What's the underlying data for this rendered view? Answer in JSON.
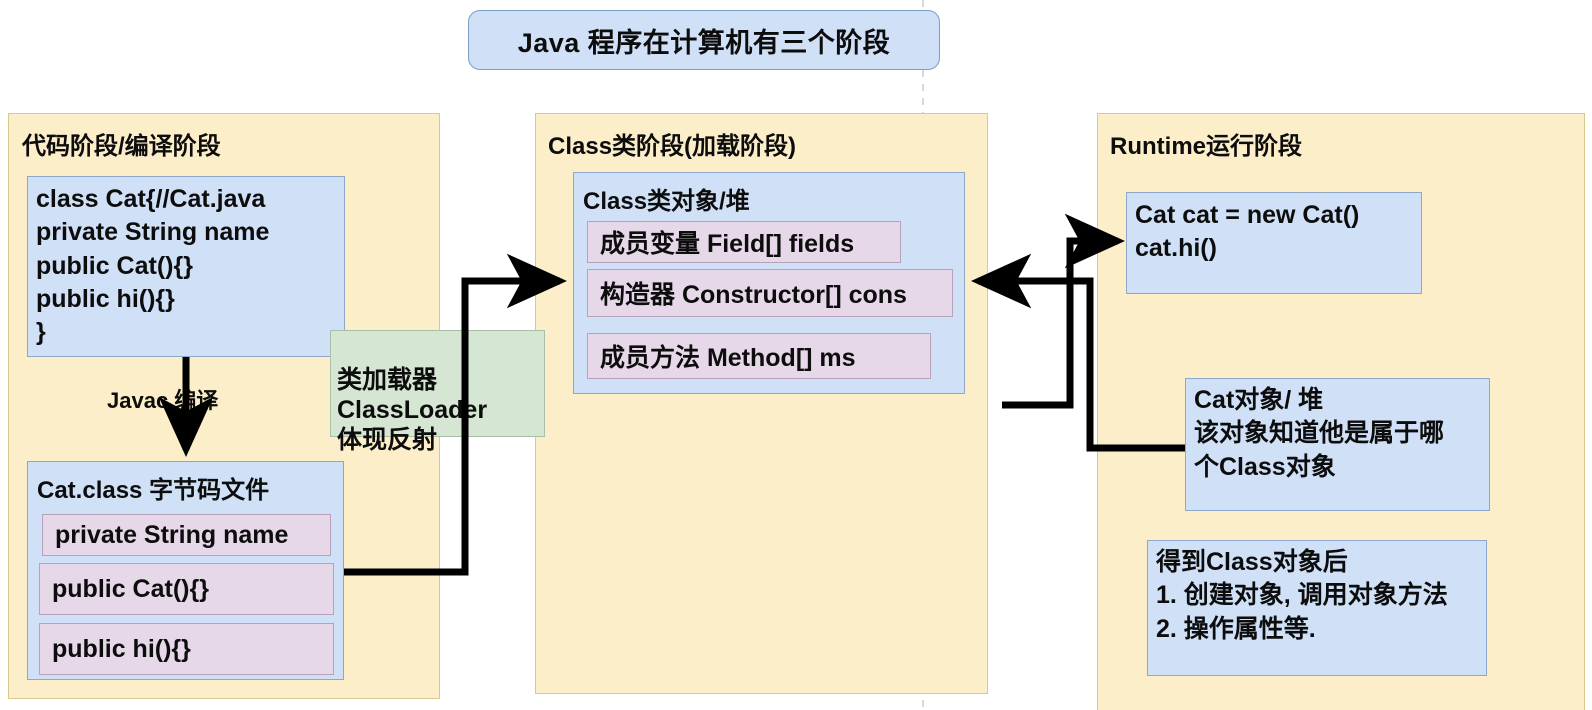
{
  "title": {
    "text": "Java 程序在计算机有三个阶段"
  },
  "stages": [
    {
      "id": "code-stage",
      "title": "代码阶段/编译阶段",
      "source_box": {
        "text": "class Cat{//Cat.java\nprivate String name\npublic Cat(){}\npublic hi(){}\n}"
      },
      "compile_label": "Javac 编译",
      "class_file_box": {
        "header": "Cat.class 字节码文件",
        "members": [
          "private String name",
          "public Cat(){}",
          "public hi(){}"
        ]
      }
    },
    {
      "id": "class-stage",
      "title": "Class类阶段(加载阶段)",
      "class_object_box": {
        "header": "Class类对象/堆",
        "members": [
          "成员变量 Field[] fields",
          "构造器 Constructor[] cons",
          "成员方法 Method[] ms"
        ]
      }
    },
    {
      "id": "runtime-stage",
      "title": "Runtime运行阶段",
      "runtime_code_box": {
        "text": "Cat cat = new Cat()\ncat.hi()"
      },
      "cat_object_box": {
        "text": "Cat对象/ 堆\n该对象知道他是属于哪\n个Class对象"
      },
      "usage_box": {
        "text": "得到Class对象后\n1. 创建对象, 调用对象方法\n2. 操作属性等."
      }
    }
  ],
  "notes": {
    "class_loader": "类加载器\nClassLoader\n体现反射"
  },
  "colors": {
    "stage_fill": "#fceec9",
    "stage_border": "#d9c98f",
    "blue_fill": "#cfe0f7",
    "blue_border": "#8fa8c8",
    "lavender_fill": "#e6d8e8",
    "lavender_border": "#b6a2bb",
    "green_fill": "#d5e6d3",
    "green_border": "#a9bfa7",
    "connector": "#000000",
    "guide": "#cccccc"
  }
}
